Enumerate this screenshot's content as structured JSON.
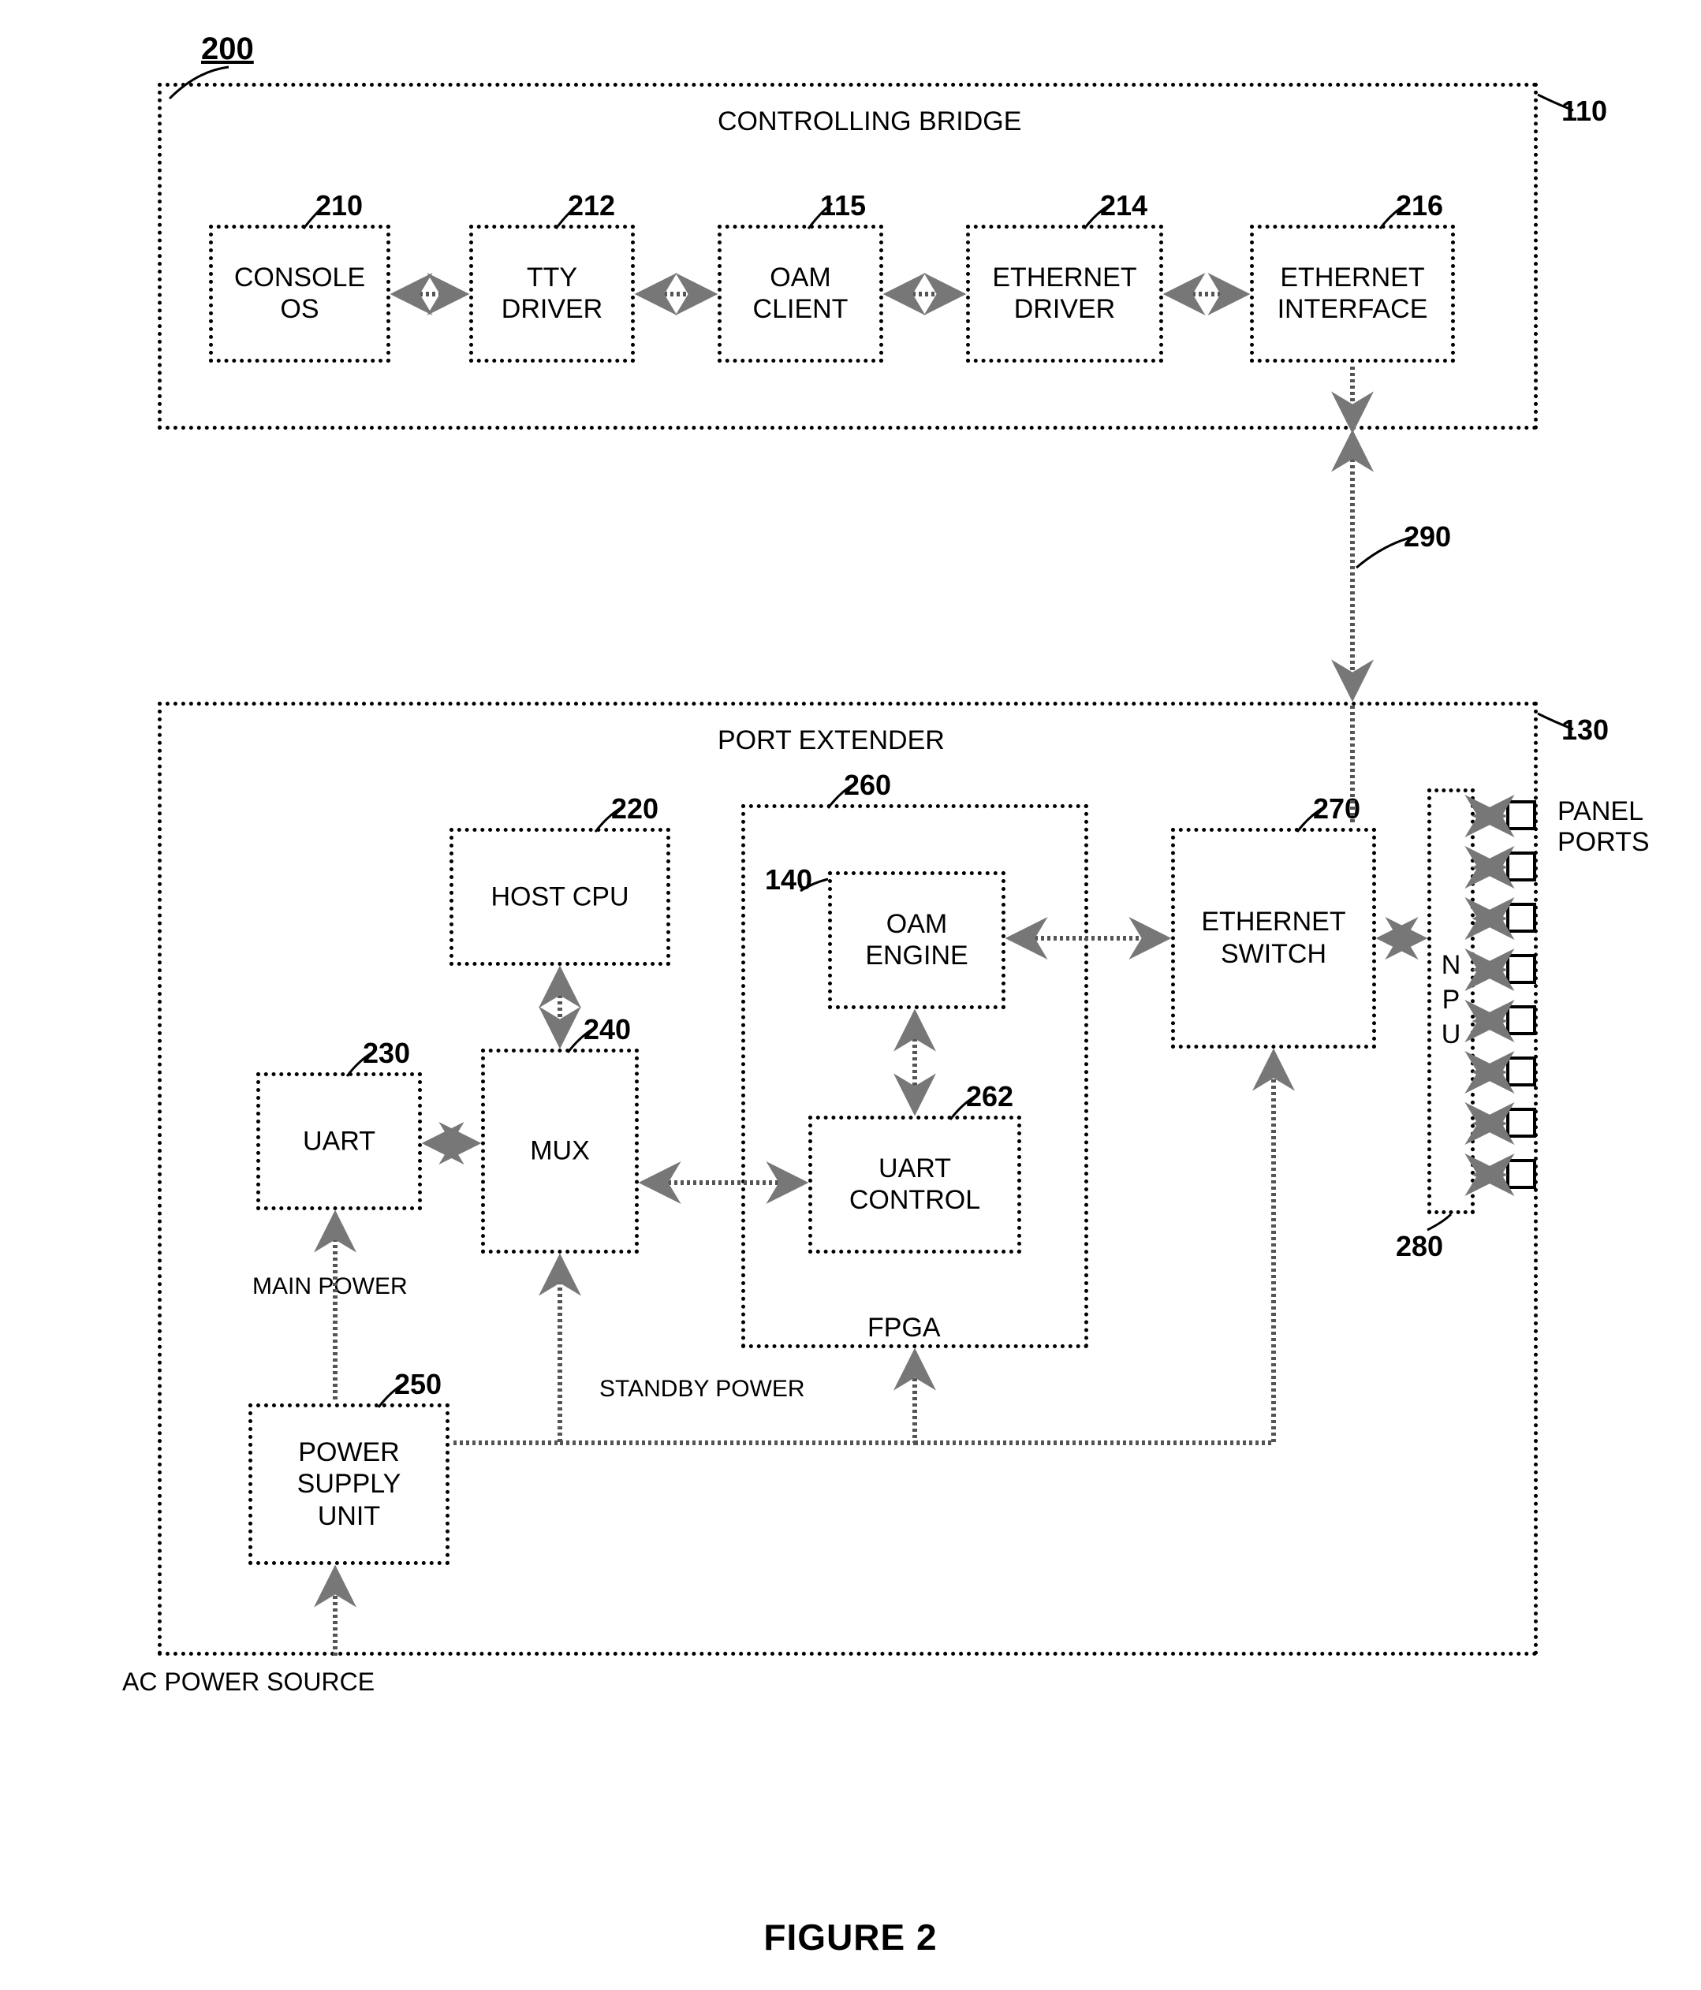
{
  "figure_ref": "200",
  "figure_caption": "FIGURE 2",
  "controlling_bridge": {
    "title": "CONTROLLING BRIDGE",
    "ref": "110",
    "console_os": {
      "label": "CONSOLE\nOS",
      "ref": "210"
    },
    "tty_driver": {
      "label": "TTY\nDRIVER",
      "ref": "212"
    },
    "oam_client": {
      "label": "OAM\nCLIENT",
      "ref": "115"
    },
    "eth_driver": {
      "label": "ETHERNET\nDRIVER",
      "ref": "214"
    },
    "eth_interface": {
      "label": "ETHERNET\nINTERFACE",
      "ref": "216"
    }
  },
  "link_ref": "290",
  "port_extender": {
    "title": "PORT EXTENDER",
    "ref": "130",
    "host_cpu": {
      "label": "HOST CPU",
      "ref": "220"
    },
    "uart": {
      "label": "UART",
      "ref": "230"
    },
    "mux": {
      "label": "MUX",
      "ref": "240"
    },
    "psu": {
      "label": "POWER\nSUPPLY\nUNIT",
      "ref": "250"
    },
    "fpga": {
      "label": "FPGA",
      "ref": "260",
      "oam_engine": {
        "label": "OAM\nENGINE",
        "ref": "140"
      },
      "uart_control": {
        "label": "UART\nCONTROL",
        "ref": "262"
      }
    },
    "eth_switch": {
      "label": "ETHERNET\nSWITCH",
      "ref": "270"
    },
    "npu": {
      "label": "NPU",
      "ref": "280"
    },
    "panel_ports_label": "PANEL\nPORTS",
    "main_power_label": "MAIN POWER",
    "standby_power_label": "STANDBY POWER",
    "ac_power_label": "AC POWER SOURCE"
  }
}
